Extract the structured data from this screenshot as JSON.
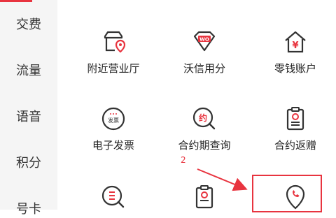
{
  "sidebar": {
    "items": [
      {
        "label": "交费"
      },
      {
        "label": "流量"
      },
      {
        "label": "语音"
      },
      {
        "label": "积分"
      },
      {
        "label": "号卡"
      }
    ]
  },
  "services": [
    {
      "label": "附近营业厅",
      "icon": "store-location-icon"
    },
    {
      "label": "沃信用分",
      "icon": "diamond-wo-icon"
    },
    {
      "label": "零钱账户",
      "icon": "yen-house-icon"
    },
    {
      "label": "电子发票",
      "icon": "invoice-badge-icon"
    },
    {
      "label": "合约期查询",
      "icon": "contract-search-icon"
    },
    {
      "label": "合约返赠",
      "icon": "clipboard-icon"
    },
    {
      "label": "",
      "icon": "list-search-icon"
    },
    {
      "label": "",
      "icon": "clipboard-icon"
    },
    {
      "label": "",
      "icon": "phone-location-icon"
    }
  ],
  "icon_texts": {
    "wo": "WO",
    "yen": "¥",
    "invoice": "发票",
    "contract": "约"
  },
  "annotation": {
    "step": "2",
    "color": "#e8343f"
  },
  "colors": {
    "accent": "#e8343f",
    "icon_stroke": "#333333",
    "sidebar_bg": "#f5f5f5"
  }
}
